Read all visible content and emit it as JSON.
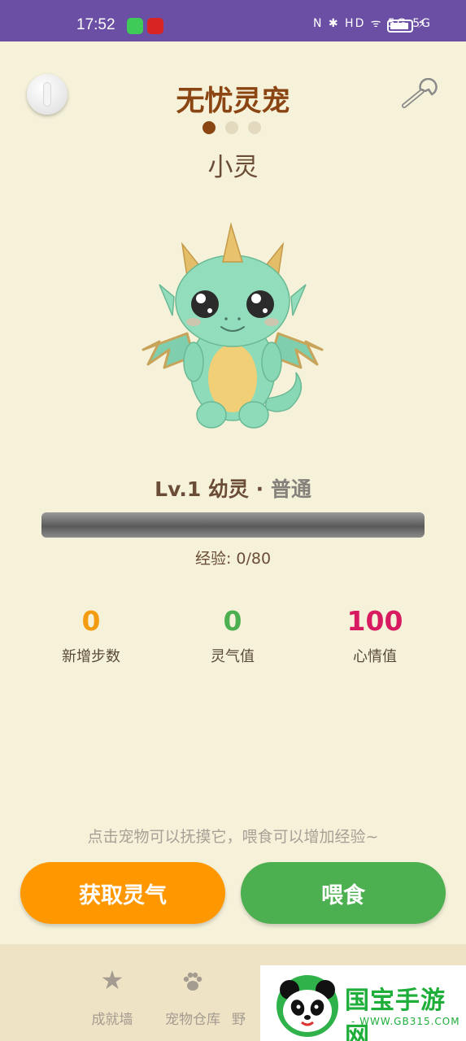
{
  "status_bar": {
    "time": "17:52",
    "indicators": "N ✱ HD ᯤ 5G 5G"
  },
  "header": {
    "title": "无忧灵宠",
    "pager_count": 3,
    "pager_active": 1
  },
  "pet": {
    "name": "小灵",
    "level_text": "Lv.1 幼灵 · ",
    "rarity": "普通",
    "exp_text": "经验: 0/80",
    "exp_fraction": 0.0
  },
  "stats": [
    {
      "value": "0",
      "label": "新增步数",
      "color": "#f39c12"
    },
    {
      "value": "0",
      "label": "灵气值",
      "color": "#4caf50"
    },
    {
      "value": "100",
      "label": "心情值",
      "color": "#d81b60"
    }
  ],
  "hint": "点击宠物可以抚摸它，喂食可以增加经验~",
  "buttons": {
    "get_spirit": "获取灵气",
    "feed": "喂食"
  },
  "tabs": [
    {
      "label": "成就墙",
      "icon": "star-icon"
    },
    {
      "label": "宠物仓库",
      "icon": "paw-icon"
    },
    {
      "label": "野",
      "icon": "tab-icon"
    }
  ],
  "watermark": {
    "brand": "国宝手游网",
    "url": "- WWW.GB315.COM -"
  },
  "colors": {
    "background": "#f6f2da",
    "accent": "#8b4513",
    "orange": "#ff9800",
    "green": "#4caf50",
    "status_bar": "#6a4fa4"
  }
}
